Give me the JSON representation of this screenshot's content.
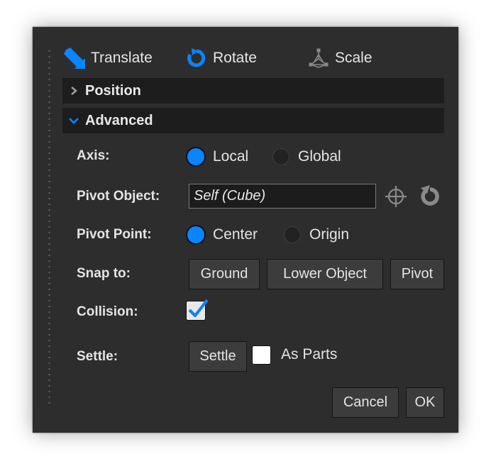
{
  "toolbar": {
    "translate_label": "Translate",
    "rotate_label": "Rotate",
    "scale_label": "Scale"
  },
  "sections": {
    "position_title": "Position",
    "advanced_title": "Advanced"
  },
  "axis": {
    "label": "Axis:",
    "options": [
      "Local",
      "Global"
    ],
    "selected": "Local"
  },
  "pivot_object": {
    "label": "Pivot Object:",
    "value": "Self (Cube)"
  },
  "pivot_point": {
    "label": "Pivot Point:",
    "options": [
      "Center",
      "Origin"
    ],
    "selected": "Center"
  },
  "snap_to": {
    "label": "Snap to:",
    "buttons": [
      "Ground",
      "Lower Object",
      "Pivot"
    ]
  },
  "collision": {
    "label": "Collision:",
    "checked": true
  },
  "settle": {
    "label": "Settle:",
    "button": "Settle",
    "as_parts_label": "As Parts",
    "as_parts_checked": false
  },
  "footer": {
    "cancel_label": "Cancel",
    "ok_label": "OK"
  },
  "colors": {
    "accent": "#0b84ff",
    "panel_bg": "#2d2d2d",
    "section_bg": "#1d1d1d"
  },
  "icons": {
    "translate": "arrow-move-icon",
    "rotate": "rotate-icon",
    "scale": "scale-gizmo-icon",
    "pick": "crosshair-icon",
    "reset": "reset-icon"
  }
}
